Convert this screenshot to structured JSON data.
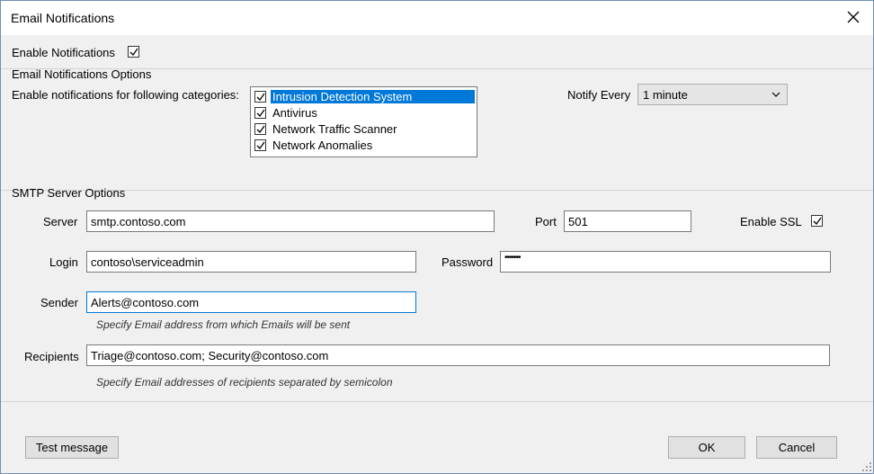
{
  "window": {
    "title": "Email Notifications"
  },
  "enable_notifications": {
    "label": "Enable Notifications",
    "checked": true
  },
  "email_options": {
    "group_label": "Email Notifications Options",
    "categories_label": "Enable notifications for following categories:",
    "categories": [
      {
        "label": "Intrusion Detection System",
        "checked": true,
        "selected": true
      },
      {
        "label": "Antivirus",
        "checked": true,
        "selected": false
      },
      {
        "label": "Network Traffic Scanner",
        "checked": true,
        "selected": false
      },
      {
        "label": "Network Anomalies",
        "checked": true,
        "selected": false
      }
    ],
    "notify_every_label": "Notify Every",
    "notify_every_value": "1 minute"
  },
  "smtp": {
    "group_label": "SMTP Server Options",
    "server_label": "Server",
    "server_value": "smtp.contoso.com",
    "port_label": "Port",
    "port_value": "501",
    "ssl_label": "Enable SSL",
    "ssl_checked": true,
    "login_label": "Login",
    "login_value": "contoso\\serviceadmin",
    "password_label": "Password",
    "password_value": "•••••••",
    "sender_label": "Sender",
    "sender_value": "Alerts@contoso.com",
    "sender_hint": "Specify Email address from which Emails will be sent",
    "recipients_label": "Recipients",
    "recipients_value": "Triage@contoso.com; Security@contoso.com",
    "recipients_hint": "Specify Email addresses of recipients separated by semicolon"
  },
  "buttons": {
    "test": "Test message",
    "ok": "OK",
    "cancel": "Cancel"
  },
  "icons": {
    "close": "close-icon",
    "checkmark": "checkmark-icon",
    "dropdown": "chevron-down-icon",
    "grip": "resize-grip-icon"
  },
  "colors": {
    "selection": "#0078d7",
    "focus_border": "#0078d7"
  }
}
